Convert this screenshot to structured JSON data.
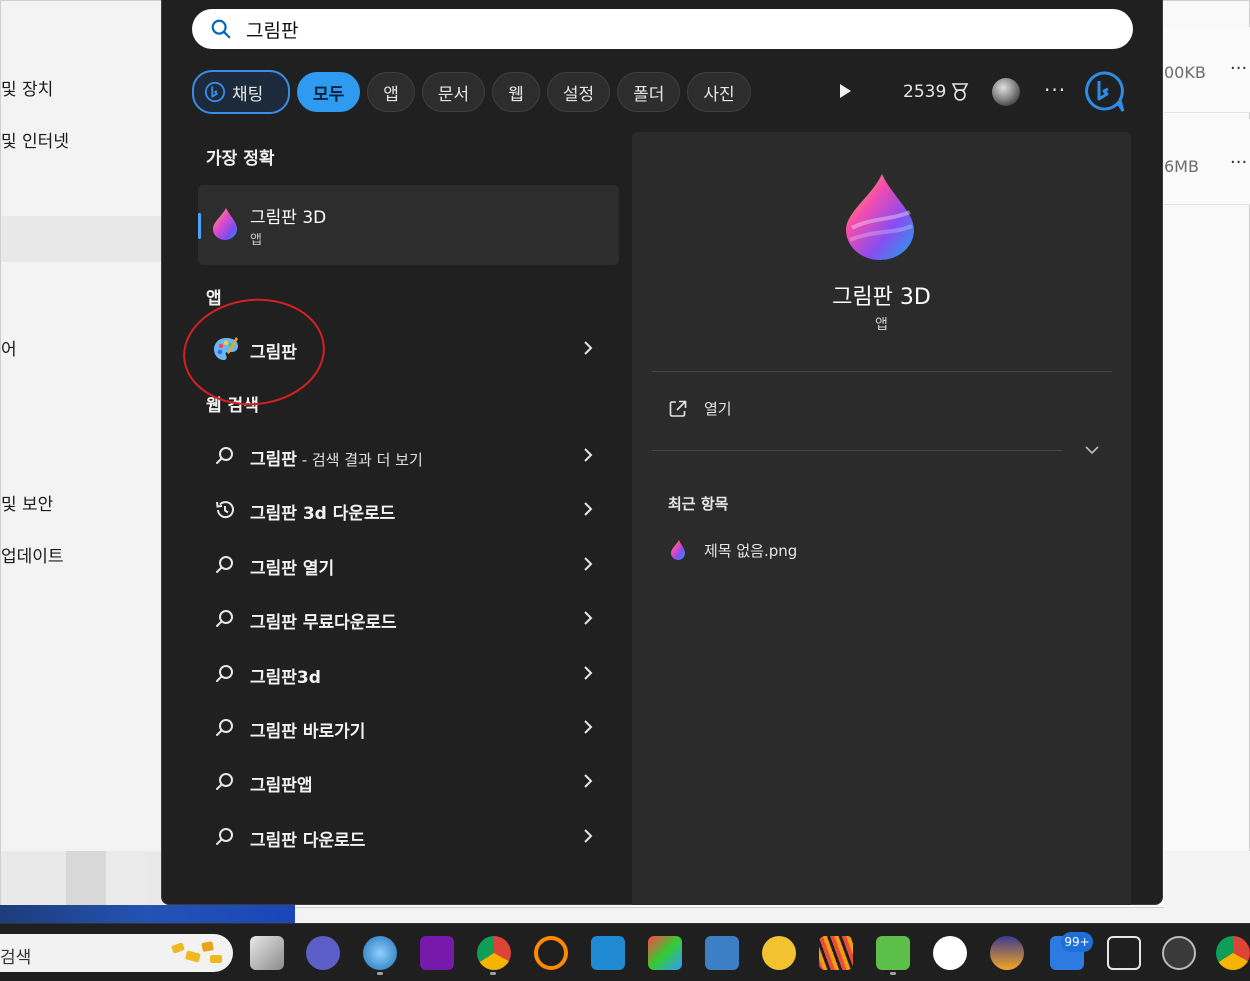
{
  "background_window": {
    "left_items": [
      "및 장치",
      "및 인터넷",
      "어",
      "및 보안",
      "업데이트"
    ],
    "right_rows": [
      {
        "size": "00KB",
        "menu": "···"
      },
      {
        "size": "6MB",
        "menu": "···"
      }
    ]
  },
  "search": {
    "query": "그림판"
  },
  "filter_chips": {
    "chat": "채팅",
    "items": [
      "모두",
      "앱",
      "문서",
      "웹",
      "설정",
      "폴더",
      "사진"
    ],
    "active": "모두"
  },
  "toolbar": {
    "points": "2539",
    "more": "···"
  },
  "results": {
    "best_match_heading": "가장 정확",
    "best_match": {
      "title": "그림판 3D",
      "type": "앱"
    },
    "apps_heading": "앱",
    "apps": [
      {
        "title": "그림판"
      }
    ],
    "web_heading": "웹 검색",
    "web": [
      {
        "title": "그림판",
        "suffix": " - 검색 결과 더 보기",
        "icon": "search-icon"
      },
      {
        "title": "그림판 3d 다운로드",
        "suffix": "",
        "icon": "history-icon"
      },
      {
        "title": "그림판 열기",
        "suffix": "",
        "icon": "search-icon"
      },
      {
        "title": "그림판 무료다운로드",
        "suffix": "",
        "icon": "search-icon"
      },
      {
        "title": "그림판3d",
        "suffix": "",
        "icon": "search-icon"
      },
      {
        "title": "그림판 바로가기",
        "suffix": "",
        "icon": "search-icon"
      },
      {
        "title": "그림판앱",
        "suffix": "",
        "icon": "search-icon"
      },
      {
        "title": "그림판 다운로드",
        "suffix": "",
        "icon": "search-icon"
      }
    ]
  },
  "detail": {
    "title": "그림판 3D",
    "type": "앱",
    "open_label": "열기",
    "recent_heading": "최근 항목",
    "recent_items": [
      "제목 없음.png"
    ]
  },
  "taskbar": {
    "search_label": "검색",
    "badge": "99+"
  },
  "colors": {
    "accent": "#2e9bf0",
    "flyout_bg": "#202020",
    "detail_bg": "#2b2b2b",
    "annotation_red": "#d62020"
  }
}
